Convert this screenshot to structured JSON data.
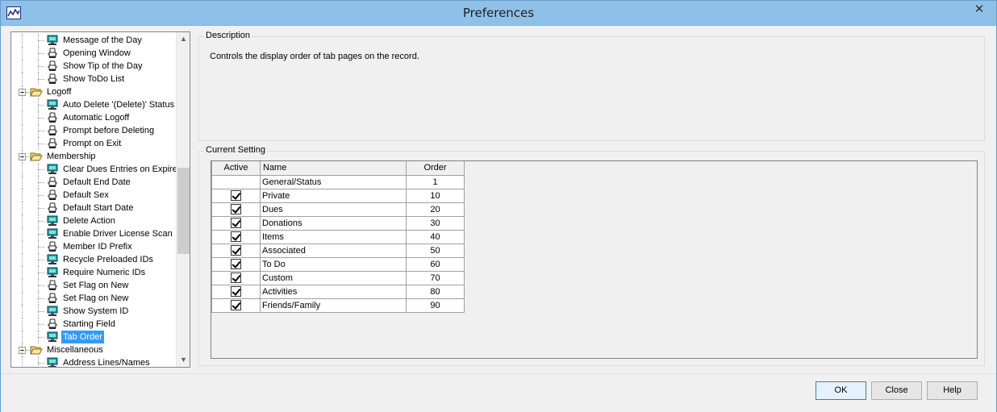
{
  "window": {
    "title": "Preferences",
    "close_glyph": "✕"
  },
  "tree": {
    "items": [
      {
        "label": "Message of the Day",
        "level": 2,
        "icon": "monitor-icon"
      },
      {
        "label": "Opening Window",
        "level": 2,
        "icon": "person-icon"
      },
      {
        "label": "Show Tip of the Day",
        "level": 2,
        "icon": "person-icon"
      },
      {
        "label": "Show ToDo List",
        "level": 2,
        "icon": "person-icon"
      },
      {
        "label": "Logoff",
        "level": 1,
        "icon": "folder-open-icon"
      },
      {
        "label": "Auto Delete '(Delete)' Status",
        "level": 2,
        "icon": "monitor-icon"
      },
      {
        "label": "Automatic Logoff",
        "level": 2,
        "icon": "person-icon"
      },
      {
        "label": "Prompt before Deleting",
        "level": 2,
        "icon": "person-icon"
      },
      {
        "label": "Prompt on Exit",
        "level": 2,
        "icon": "person-icon"
      },
      {
        "label": "Membership",
        "level": 1,
        "icon": "folder-open-icon"
      },
      {
        "label": "Clear Dues Entries on Expire",
        "level": 2,
        "icon": "monitor-icon"
      },
      {
        "label": "Default End Date",
        "level": 2,
        "icon": "person-icon"
      },
      {
        "label": "Default Sex",
        "level": 2,
        "icon": "person-icon"
      },
      {
        "label": "Default Start Date",
        "level": 2,
        "icon": "person-icon"
      },
      {
        "label": "Delete Action",
        "level": 2,
        "icon": "monitor-icon"
      },
      {
        "label": "Enable Driver License Scan",
        "level": 2,
        "icon": "monitor-icon"
      },
      {
        "label": "Member ID Prefix",
        "level": 2,
        "icon": "person-icon"
      },
      {
        "label": "Recycle Preloaded IDs",
        "level": 2,
        "icon": "monitor-icon"
      },
      {
        "label": "Require Numeric IDs",
        "level": 2,
        "icon": "monitor-icon"
      },
      {
        "label": "Set Flag on New",
        "level": 2,
        "icon": "person-icon"
      },
      {
        "label": "Set Flag on New",
        "level": 2,
        "icon": "person-icon"
      },
      {
        "label": "Show System ID",
        "level": 2,
        "icon": "monitor-icon"
      },
      {
        "label": "Starting Field",
        "level": 2,
        "icon": "person-icon"
      },
      {
        "label": "Tab Order",
        "level": 2,
        "icon": "monitor-icon",
        "selected": true
      },
      {
        "label": "Miscellaneous",
        "level": 1,
        "icon": "folder-open-icon"
      },
      {
        "label": "Address Lines/Names",
        "level": 2,
        "icon": "monitor-icon"
      }
    ],
    "scroll_up": "▲",
    "scroll_down": "▼"
  },
  "description": {
    "title": "Description",
    "text": "Controls the display order of tab pages on the record."
  },
  "current_setting": {
    "title": "Current Setting",
    "columns": {
      "active": "Active",
      "name": "Name",
      "order": "Order"
    },
    "rows": [
      {
        "active": null,
        "name": "General/Status",
        "order": "1"
      },
      {
        "active": true,
        "name": "Private",
        "order": "10"
      },
      {
        "active": true,
        "name": "Dues",
        "order": "20"
      },
      {
        "active": true,
        "name": "Donations",
        "order": "30"
      },
      {
        "active": true,
        "name": "Items",
        "order": "40"
      },
      {
        "active": true,
        "name": "Associated",
        "order": "50"
      },
      {
        "active": true,
        "name": "To Do",
        "order": "60"
      },
      {
        "active": true,
        "name": "Custom",
        "order": "70"
      },
      {
        "active": true,
        "name": "Activities",
        "order": "80"
      },
      {
        "active": true,
        "name": "Friends/Family",
        "order": "90"
      }
    ]
  },
  "buttons": {
    "ok": "OK",
    "close": "Close",
    "help": "Help"
  },
  "colors": {
    "titlebar": "#8fc1e8",
    "selection": "#3399ff"
  }
}
